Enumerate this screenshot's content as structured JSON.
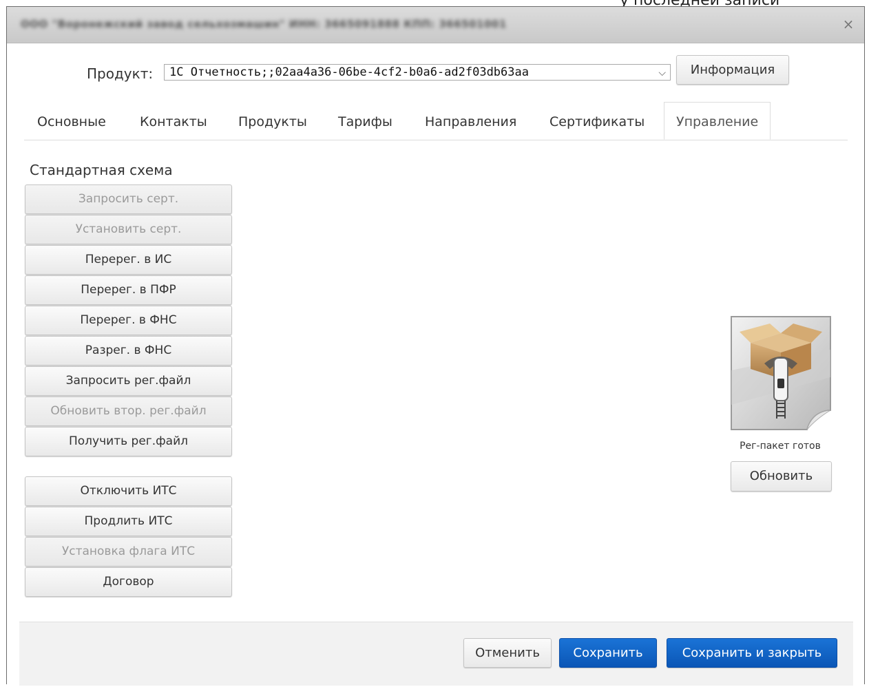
{
  "top_cut_text": "у последней записи",
  "dialog": {
    "title": "ООО \"Воронежский завод сельхозмашин\" ИНН: 3665091888 КПП: 366501001",
    "close_glyph": "×"
  },
  "product": {
    "label": "Продукт:",
    "selected": "1С Отчетность;;02aa4a36-06be-4cf2-b0a6-ad2f03db63aa",
    "info_button": "Информация"
  },
  "tabs": [
    {
      "label": "Основные"
    },
    {
      "label": "Контакты"
    },
    {
      "label": "Продукты"
    },
    {
      "label": "Тарифы"
    },
    {
      "label": "Направления"
    },
    {
      "label": "Сертификаты"
    },
    {
      "label": "Управление",
      "active": true
    }
  ],
  "scheme": {
    "title": "Стандартная схема",
    "buttons": [
      {
        "label": "Запросить серт.",
        "disabled": true
      },
      {
        "label": "Установить серт.",
        "disabled": true
      },
      {
        "label": "Перерег. в ИС",
        "disabled": false
      },
      {
        "label": "Перерег. в ПФР",
        "disabled": false
      },
      {
        "label": "Перерег. в ФНС",
        "disabled": false
      },
      {
        "label": "Разрег. в ФНС",
        "disabled": false
      },
      {
        "label": "Запросить рег.файл",
        "disabled": false
      },
      {
        "label": "Обновить втор. рег.файл",
        "disabled": true
      },
      {
        "label": "Получить рег.файл",
        "disabled": false
      }
    ],
    "its_buttons": [
      {
        "label": "Отключить ИТС",
        "disabled": false
      },
      {
        "label": "Продлить ИТС",
        "disabled": false
      },
      {
        "label": "Установка флага ИТС",
        "disabled": true
      },
      {
        "label": "Договор",
        "disabled": false
      }
    ]
  },
  "package": {
    "icon": "zip-archive-icon",
    "status": "Рег-пакет готов",
    "refresh_button": "Обновить"
  },
  "footer": {
    "cancel": "Отменить",
    "save": "Сохранить",
    "save_close": "Сохранить и закрыть"
  },
  "colors": {
    "primary": "#0b5fc4",
    "disabled_text": "#9a9a9a"
  }
}
